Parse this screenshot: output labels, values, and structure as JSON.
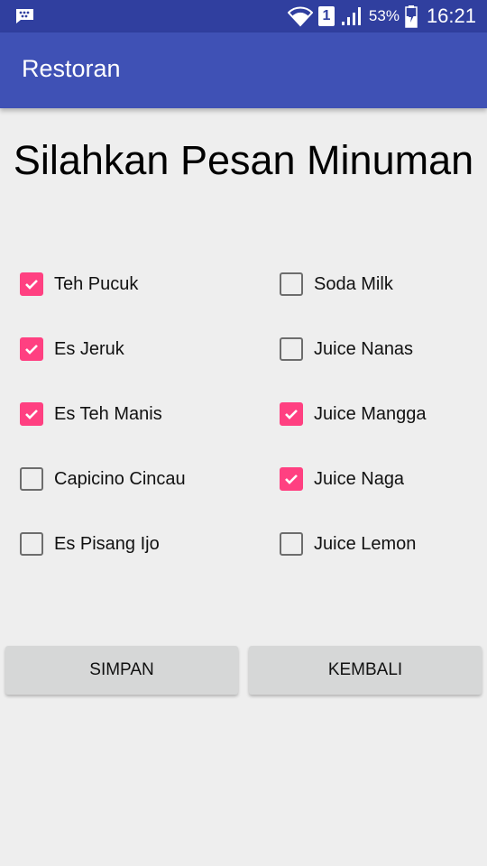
{
  "status_bar": {
    "battery_percent": "53%",
    "time": "16:21",
    "sim_slot": "1",
    "icons": [
      "bbm-icon",
      "wifi-icon",
      "sim-icon",
      "signal-icon",
      "battery-icon"
    ]
  },
  "app_bar": {
    "title": "Restoran"
  },
  "heading": "Silahkan Pesan Minuman",
  "drinks": {
    "left": [
      {
        "label": "Teh Pucuk",
        "checked": true
      },
      {
        "label": "Es Jeruk",
        "checked": true
      },
      {
        "label": "Es Teh Manis",
        "checked": true
      },
      {
        "label": "Capicino Cincau",
        "checked": false
      },
      {
        "label": "Es Pisang Ijo",
        "checked": false
      }
    ],
    "right": [
      {
        "label": "Soda Milk",
        "checked": false
      },
      {
        "label": "Juice Nanas",
        "checked": false
      },
      {
        "label": "Juice Mangga",
        "checked": true
      },
      {
        "label": "Juice Naga",
        "checked": true
      },
      {
        "label": "Juice Lemon",
        "checked": false
      }
    ]
  },
  "buttons": {
    "save": "SIMPAN",
    "back": "KEMBALI"
  },
  "colors": {
    "status_bar": "#303f9f",
    "app_bar": "#3f51b5",
    "checkbox_accent": "#ff4081",
    "background": "#eeeeee"
  }
}
